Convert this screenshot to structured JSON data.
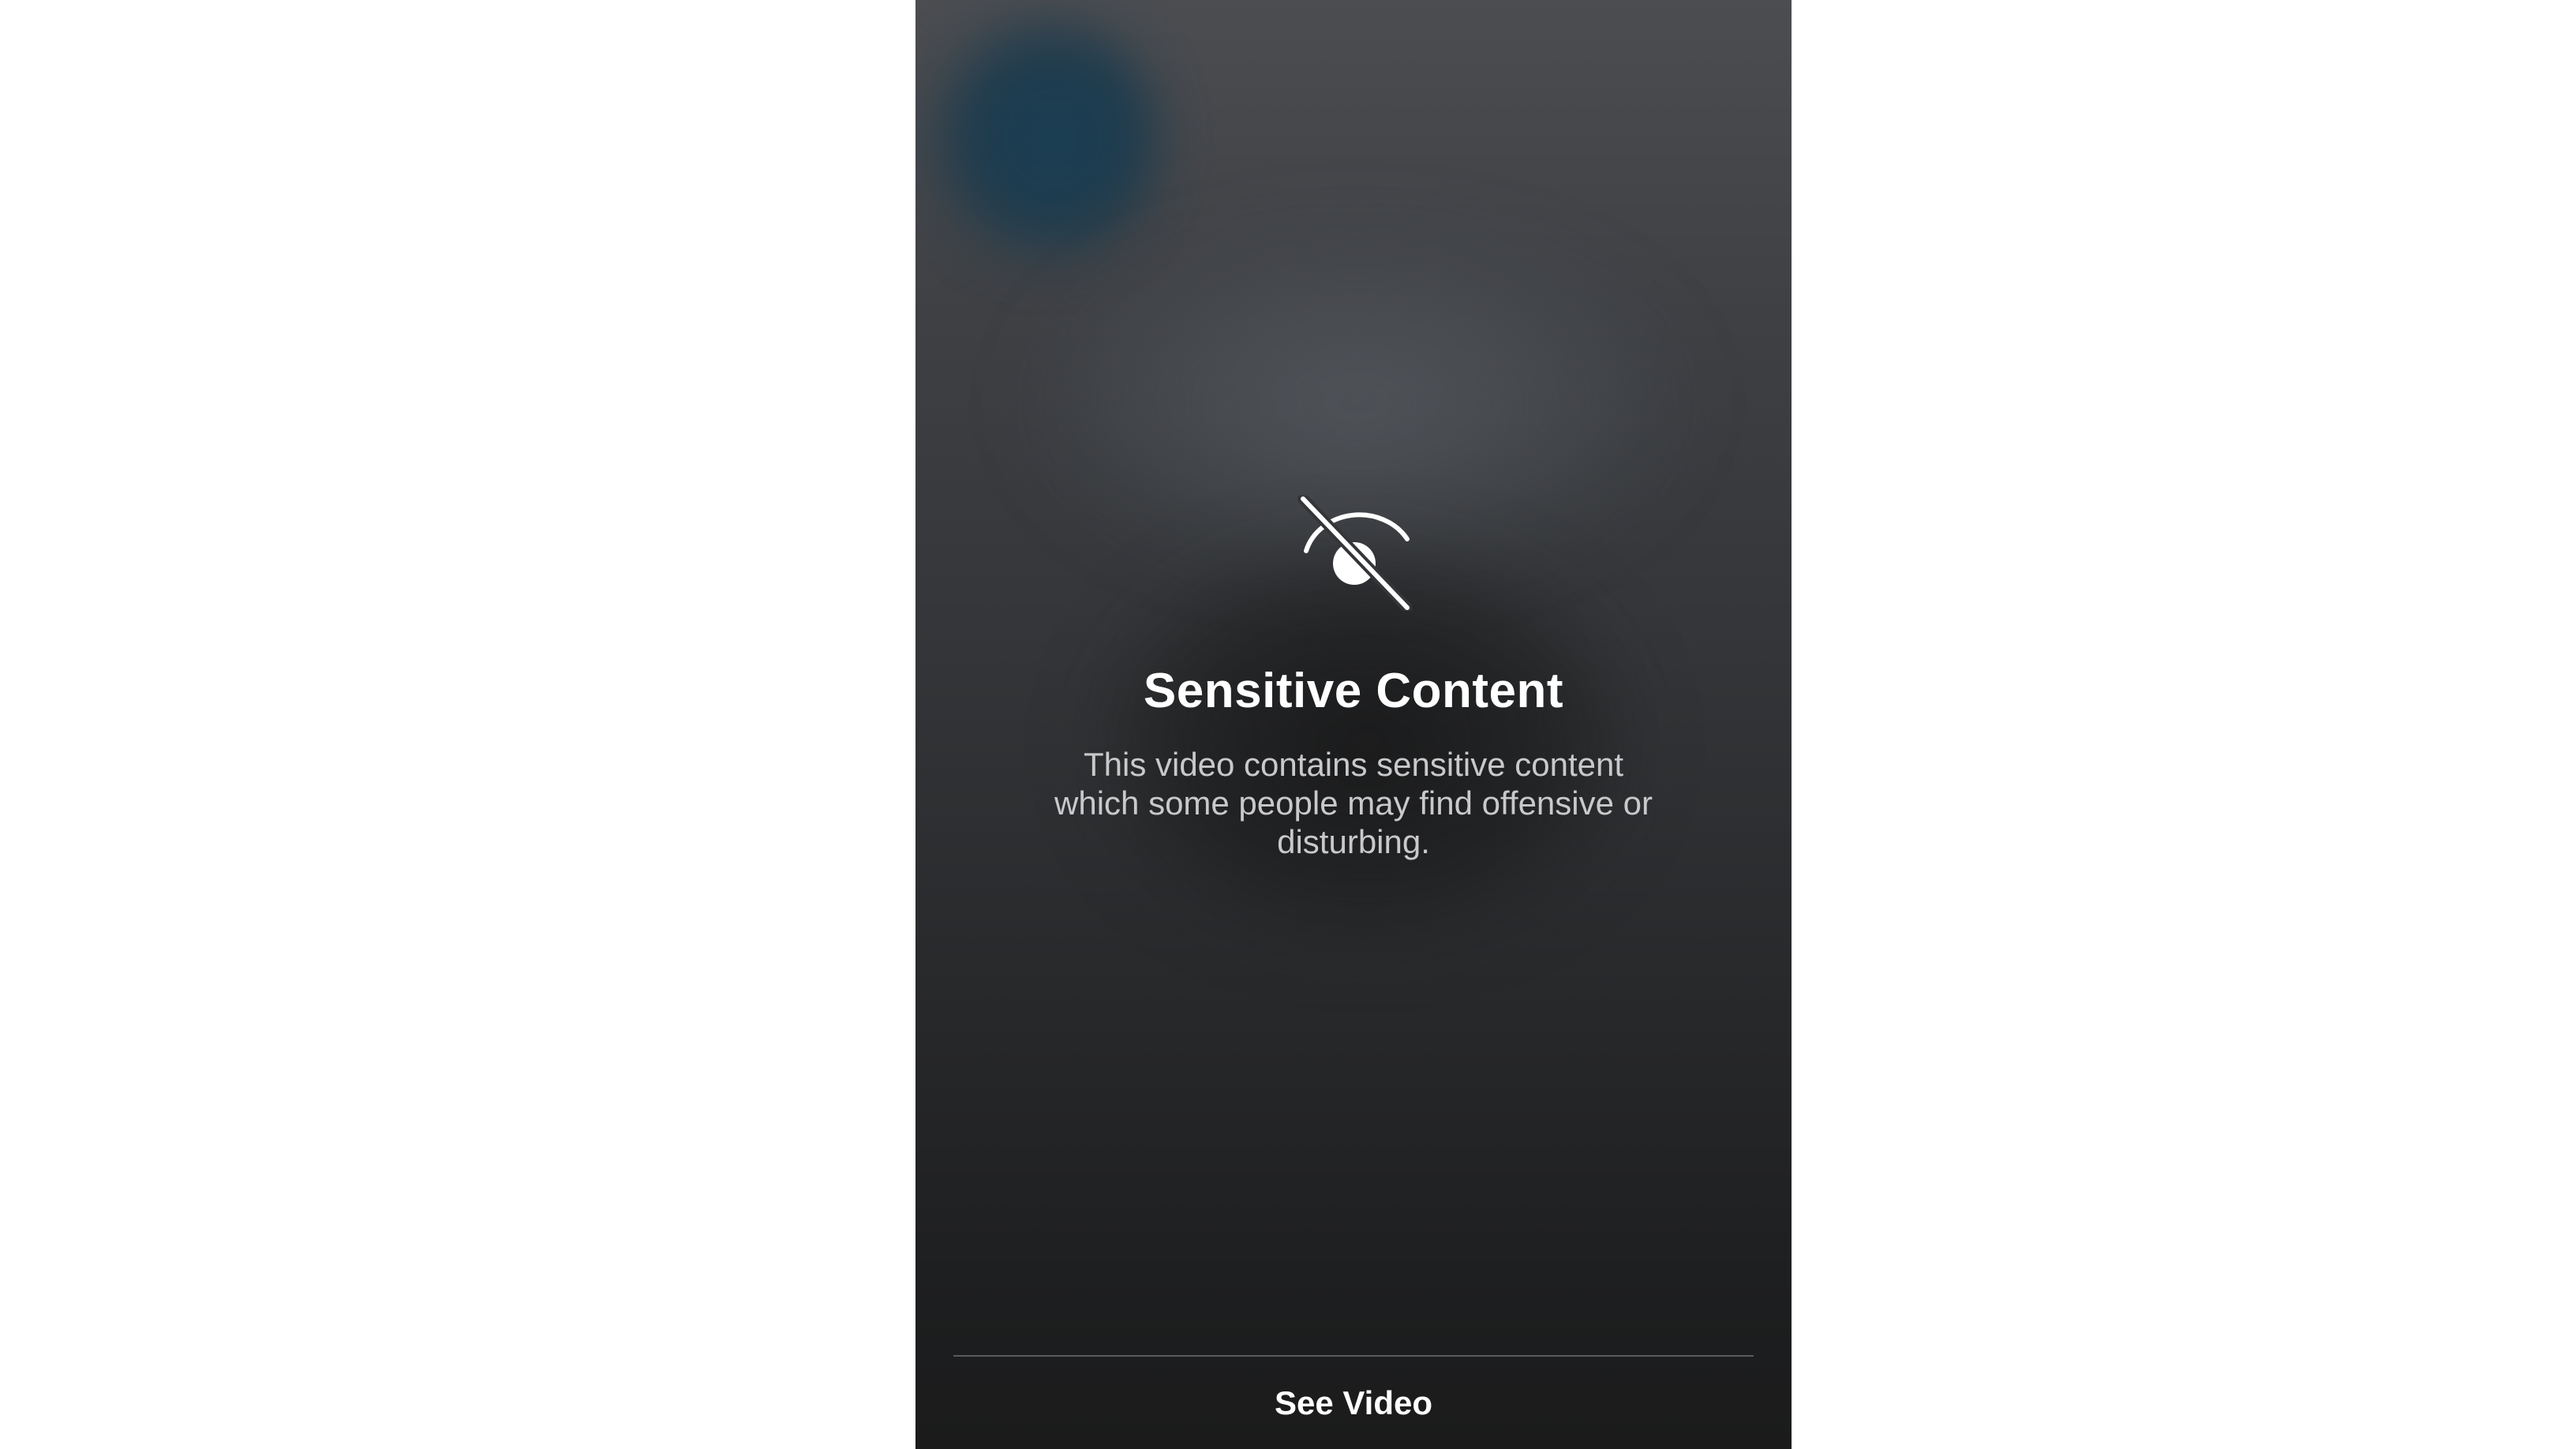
{
  "overlay": {
    "icon": "eye-slash-icon",
    "title": "Sensitive Content",
    "description": "This video contains sensitive content which some people may find offensive or disturbing.",
    "action_label": "See Video"
  },
  "colors": {
    "text_primary": "#ffffff",
    "text_secondary": "#c9c9cb",
    "background_top": "#4b4d51",
    "background_bottom": "#1b1b1c",
    "page_background": "#ffffff"
  }
}
